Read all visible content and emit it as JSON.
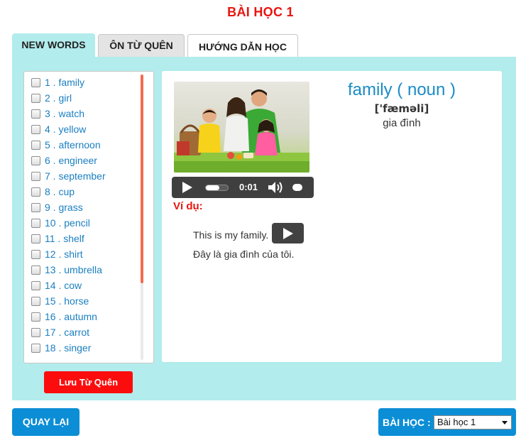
{
  "page": {
    "title": "BÀI HỌC 1"
  },
  "tabs": [
    {
      "label": "NEW WORDS",
      "active": true
    },
    {
      "label": "ÔN TỪ QUÊN",
      "active": false
    },
    {
      "label": "HƯỚNG DẪN HỌC",
      "active": false
    }
  ],
  "word_list": {
    "items": [
      "1 . family",
      "2 . girl",
      "3 . watch",
      "4 . yellow",
      "5 . afternoon",
      "6 . engineer",
      "7 . september",
      "8 . cup",
      "9 . grass",
      "10 . pencil",
      "11 . shelf",
      "12 . shirt",
      "13 . umbrella",
      "14 . cow",
      "15 . horse",
      "16 . autumn",
      "17 . carrot",
      "18 . singer"
    ]
  },
  "save_button": {
    "label": "Lưu Từ Quên"
  },
  "word_detail": {
    "heading": "family ( noun )",
    "phonetic": "['fæməli]",
    "meaning": "gia đình",
    "image_icon": "family-photo",
    "audio": {
      "time": "0:01",
      "progress": 0.6
    },
    "example_label": "Ví dụ:",
    "example_en": "This is my family.",
    "example_vi": "Đây là gia đình của tôi."
  },
  "footer": {
    "back_label": "QUAY LẠI",
    "lesson_label": "BÀI HỌC :",
    "lesson_selected": "Bài học 1"
  },
  "colors": {
    "accent_red": "#e8150f",
    "panel_bg": "#b2ecec",
    "link_blue": "#1a7fc1",
    "button_blue": "#0b8ed6"
  }
}
